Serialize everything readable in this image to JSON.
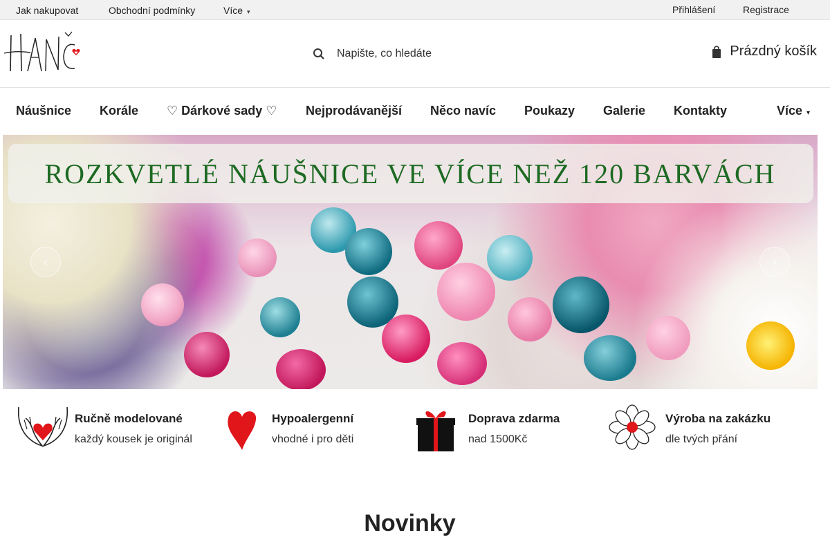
{
  "topbar": {
    "links": [
      "Jak nakupovat",
      "Obchodní podmínky",
      "Více"
    ],
    "login": "Přihlášení",
    "register": "Registrace"
  },
  "header": {
    "logo_alt": "HANČ",
    "search_placeholder": "Napište, co hledáte",
    "cart_label": "Prázdný košík"
  },
  "nav": {
    "items": [
      "Náušnice",
      "Korále",
      "♡ Dárkové sady ♡",
      "Nejprodávanější",
      "Něco navíc",
      "Poukazy",
      "Galerie",
      "Kontakty",
      "Více"
    ]
  },
  "banner": {
    "headline": "ROZKVETLÉ NÁUŠNICE VE VÍCE NEŽ 120 BARVÁCH",
    "prev_icon": "chevron-left-icon",
    "next_icon": "chevron-right-icon"
  },
  "features": [
    {
      "title": "Ručně modelované",
      "subtitle": "každý kousek je originál",
      "icon": "hands-heart-icon"
    },
    {
      "title": "Hypoalergenní",
      "subtitle": "vhodné i pro děti",
      "icon": "heart-icon"
    },
    {
      "title": "Doprava zdarma",
      "subtitle": "nad 1500Kč",
      "icon": "gift-icon"
    },
    {
      "title": "Výroba na zakázku",
      "subtitle": "dle tvých přání",
      "icon": "flower-icon"
    }
  ],
  "section": {
    "title": "Novinky"
  },
  "colors": {
    "accent_red": "#e0161b",
    "headline_green": "#1d6a22",
    "topbar_bg": "#f1f1f1"
  }
}
